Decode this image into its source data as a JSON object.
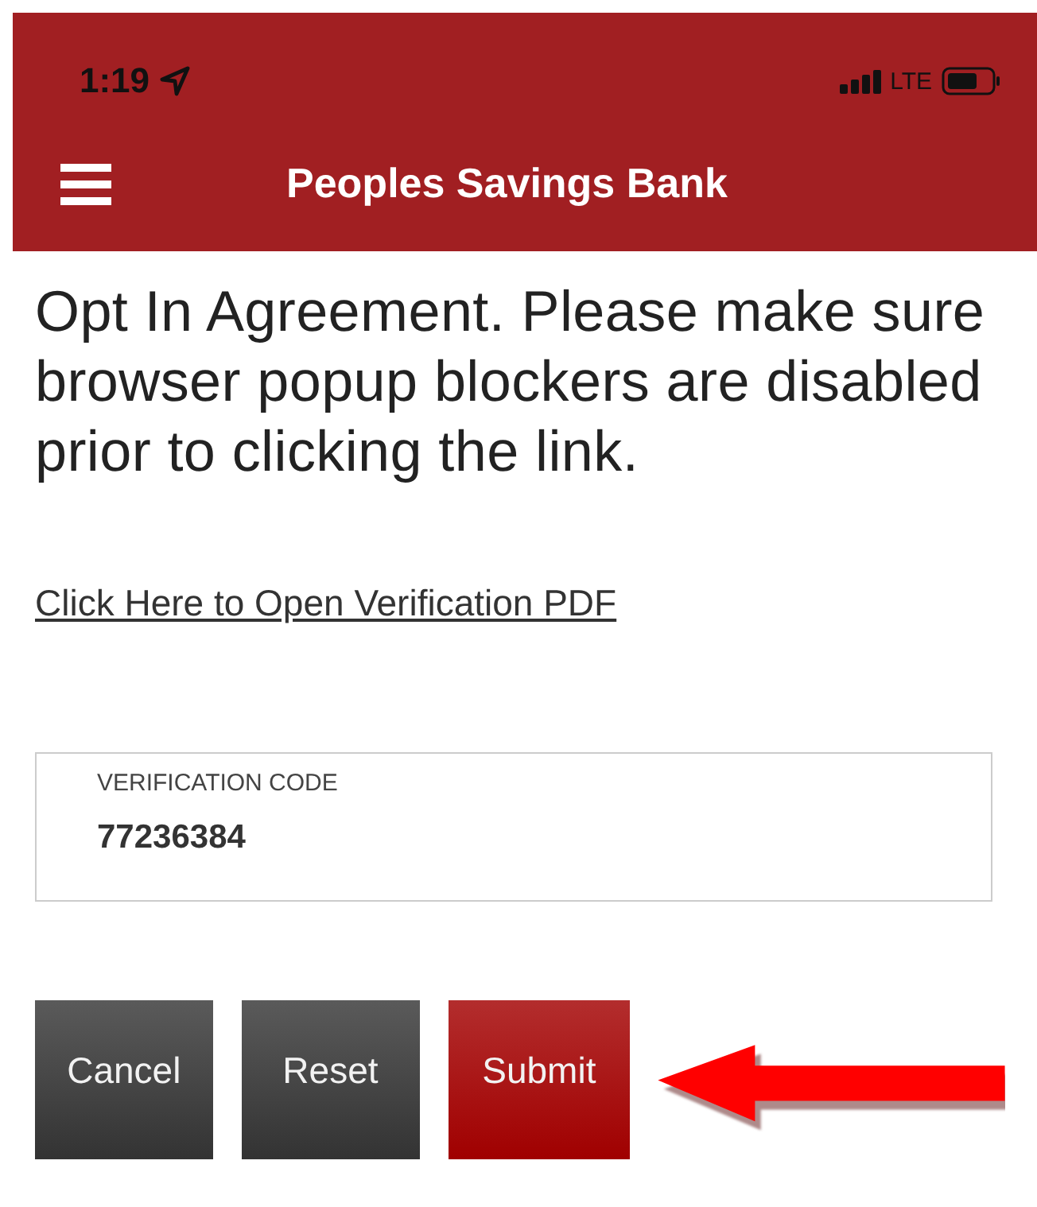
{
  "status_bar": {
    "time": "1:19",
    "network": "LTE"
  },
  "header": {
    "title": "Peoples Savings Bank"
  },
  "body": {
    "paragraph": "Opt In Agreement. Please make sure browser popup blockers are disabled prior to clicking the link.",
    "link": "Click Here to Open Verification PDF"
  },
  "field": {
    "label": "VERIFICATION CODE",
    "value": "77236384"
  },
  "buttons": [
    {
      "label": "Cancel",
      "kind": "secondary"
    },
    {
      "label": "Reset",
      "kind": "secondary"
    },
    {
      "label": "Submit",
      "kind": "primary"
    }
  ]
}
